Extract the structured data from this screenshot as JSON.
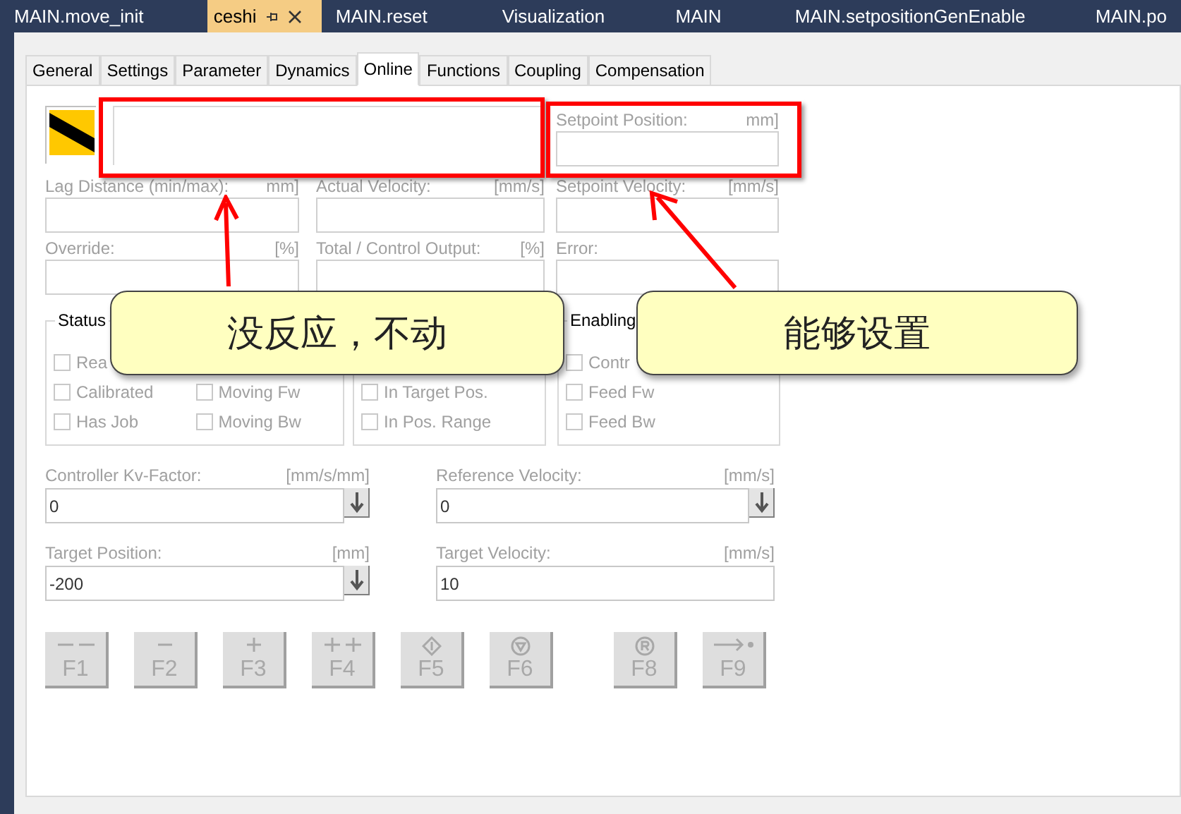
{
  "document_tabs": [
    {
      "label": "MAIN.move_init",
      "selected": false
    },
    {
      "label": "ceshi",
      "selected": true
    },
    {
      "label": "MAIN.reset",
      "selected": false
    },
    {
      "label": "Visualization",
      "selected": false
    },
    {
      "label": "MAIN",
      "selected": false
    },
    {
      "label": "MAIN.setpositionGenEnable",
      "selected": false
    },
    {
      "label": "MAIN.po",
      "selected": false
    }
  ],
  "tabs": [
    {
      "label": "General",
      "selected": false
    },
    {
      "label": "Settings",
      "selected": false
    },
    {
      "label": "Parameter",
      "selected": false
    },
    {
      "label": "Dynamics",
      "selected": false
    },
    {
      "label": "Online",
      "selected": true
    },
    {
      "label": "Functions",
      "selected": false
    },
    {
      "label": "Coupling",
      "selected": false
    },
    {
      "label": "Compensation",
      "selected": false
    }
  ],
  "readouts": [
    {
      "label": "Setpoint Position:",
      "unit": "mm]"
    },
    {
      "label": "Lag Distance (min/max):",
      "unit": "mm]"
    },
    {
      "label": "Actual Velocity:",
      "unit": "[mm/s]"
    },
    {
      "label": "Setpoint Velocity:",
      "unit": "[mm/s]"
    },
    {
      "label": "Override:",
      "unit": "[%]"
    },
    {
      "label": "Total / Control Output:",
      "unit": "[%]"
    },
    {
      "label": "Error:"
    }
  ],
  "status_groups": [
    {
      "title": "Status",
      "columns": [
        [
          {
            "label": "Rea",
            "checked": false
          },
          {
            "label": "Calibrated",
            "checked": false
          },
          {
            "label": "Has Job",
            "checked": false
          }
        ],
        [
          {
            "label": "Moving Fw",
            "checked": false
          },
          {
            "label": "Moving Bw",
            "checked": false
          }
        ]
      ]
    },
    {
      "columns": [
        [
          {
            "label": "In Target Pos.",
            "checked": false
          },
          {
            "label": "In Pos. Range",
            "checked": false
          }
        ]
      ]
    },
    {
      "title": "Enabling",
      "columns": [
        [
          {
            "label": "Contr",
            "checked": false
          },
          {
            "label": "Feed Fw",
            "checked": false
          },
          {
            "label": "Feed Bw",
            "checked": false
          }
        ]
      ]
    }
  ],
  "parameters": [
    {
      "label": "Controller Kv-Factor:",
      "unit": "[mm/s/mm]",
      "value": "0",
      "kind": "set"
    },
    {
      "label": "Reference Velocity:",
      "unit": "[mm/s]",
      "value": "0",
      "kind": "set"
    },
    {
      "label": "Target Position:",
      "unit": "[mm]",
      "value": "-200",
      "kind": "set"
    },
    {
      "label": "Target Velocity:",
      "unit": "[mm/s]",
      "value": "10",
      "kind": "plain"
    }
  ],
  "function_keys": [
    {
      "key": "F1",
      "kind": "fast-backward",
      "disabled": true
    },
    {
      "key": "F2",
      "kind": "backward",
      "disabled": true
    },
    {
      "key": "F3",
      "kind": "forward",
      "disabled": true
    },
    {
      "key": "F4",
      "kind": "fast-forward",
      "disabled": true
    },
    {
      "key": "F5",
      "kind": "start",
      "disabled": true
    },
    {
      "key": "F6",
      "kind": "stop",
      "disabled": true
    },
    {
      "key": "F8",
      "kind": "reset",
      "disabled": true
    },
    {
      "key": "F9",
      "kind": "reference",
      "disabled": true
    }
  ],
  "annotations": [
    {
      "text": "没反应，不动"
    },
    {
      "text": "能够设置"
    }
  ]
}
